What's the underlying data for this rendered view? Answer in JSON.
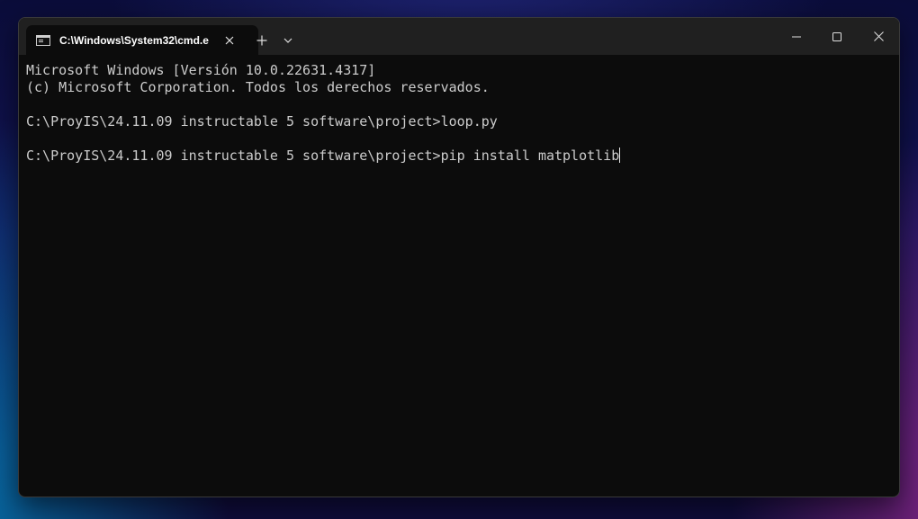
{
  "window": {
    "tab_title": "C:\\Windows\\System32\\cmd.e",
    "tab_icon": "command-prompt-icon",
    "buttons": {
      "new_tab": "plus-icon",
      "dropdown": "chevron-down-icon",
      "minimize": "minimize-icon",
      "maximize": "maximize-icon",
      "close": "close-icon"
    }
  },
  "console": {
    "lines": [
      "Microsoft Windows [Versión 10.0.22631.4317]",
      "(c) Microsoft Corporation. Todos los derechos reservados.",
      "",
      "C:\\ProyIS\\24.11.09 instructable 5 software\\project>loop.py",
      "",
      "C:\\ProyIS\\24.11.09 instructable 5 software\\project>pip install matplotlib"
    ]
  }
}
